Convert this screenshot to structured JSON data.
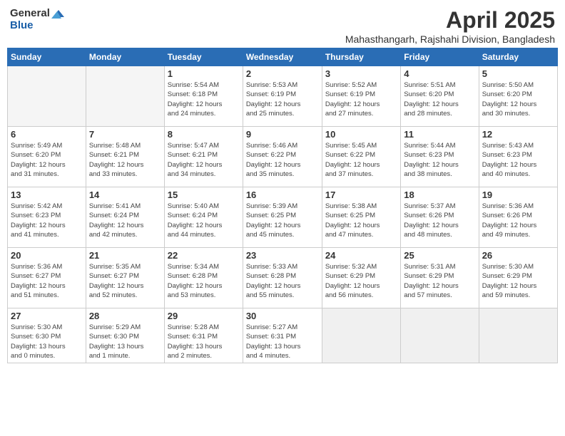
{
  "logo": {
    "general": "General",
    "blue": "Blue"
  },
  "title": "April 2025",
  "location": "Mahasthangarh, Rajshahi Division, Bangladesh",
  "headers": [
    "Sunday",
    "Monday",
    "Tuesday",
    "Wednesday",
    "Thursday",
    "Friday",
    "Saturday"
  ],
  "weeks": [
    [
      {
        "day": "",
        "info": ""
      },
      {
        "day": "",
        "info": ""
      },
      {
        "day": "1",
        "info": "Sunrise: 5:54 AM\nSunset: 6:18 PM\nDaylight: 12 hours\nand 24 minutes."
      },
      {
        "day": "2",
        "info": "Sunrise: 5:53 AM\nSunset: 6:19 PM\nDaylight: 12 hours\nand 25 minutes."
      },
      {
        "day": "3",
        "info": "Sunrise: 5:52 AM\nSunset: 6:19 PM\nDaylight: 12 hours\nand 27 minutes."
      },
      {
        "day": "4",
        "info": "Sunrise: 5:51 AM\nSunset: 6:20 PM\nDaylight: 12 hours\nand 28 minutes."
      },
      {
        "day": "5",
        "info": "Sunrise: 5:50 AM\nSunset: 6:20 PM\nDaylight: 12 hours\nand 30 minutes."
      }
    ],
    [
      {
        "day": "6",
        "info": "Sunrise: 5:49 AM\nSunset: 6:20 PM\nDaylight: 12 hours\nand 31 minutes."
      },
      {
        "day": "7",
        "info": "Sunrise: 5:48 AM\nSunset: 6:21 PM\nDaylight: 12 hours\nand 33 minutes."
      },
      {
        "day": "8",
        "info": "Sunrise: 5:47 AM\nSunset: 6:21 PM\nDaylight: 12 hours\nand 34 minutes."
      },
      {
        "day": "9",
        "info": "Sunrise: 5:46 AM\nSunset: 6:22 PM\nDaylight: 12 hours\nand 35 minutes."
      },
      {
        "day": "10",
        "info": "Sunrise: 5:45 AM\nSunset: 6:22 PM\nDaylight: 12 hours\nand 37 minutes."
      },
      {
        "day": "11",
        "info": "Sunrise: 5:44 AM\nSunset: 6:23 PM\nDaylight: 12 hours\nand 38 minutes."
      },
      {
        "day": "12",
        "info": "Sunrise: 5:43 AM\nSunset: 6:23 PM\nDaylight: 12 hours\nand 40 minutes."
      }
    ],
    [
      {
        "day": "13",
        "info": "Sunrise: 5:42 AM\nSunset: 6:23 PM\nDaylight: 12 hours\nand 41 minutes."
      },
      {
        "day": "14",
        "info": "Sunrise: 5:41 AM\nSunset: 6:24 PM\nDaylight: 12 hours\nand 42 minutes."
      },
      {
        "day": "15",
        "info": "Sunrise: 5:40 AM\nSunset: 6:24 PM\nDaylight: 12 hours\nand 44 minutes."
      },
      {
        "day": "16",
        "info": "Sunrise: 5:39 AM\nSunset: 6:25 PM\nDaylight: 12 hours\nand 45 minutes."
      },
      {
        "day": "17",
        "info": "Sunrise: 5:38 AM\nSunset: 6:25 PM\nDaylight: 12 hours\nand 47 minutes."
      },
      {
        "day": "18",
        "info": "Sunrise: 5:37 AM\nSunset: 6:26 PM\nDaylight: 12 hours\nand 48 minutes."
      },
      {
        "day": "19",
        "info": "Sunrise: 5:36 AM\nSunset: 6:26 PM\nDaylight: 12 hours\nand 49 minutes."
      }
    ],
    [
      {
        "day": "20",
        "info": "Sunrise: 5:36 AM\nSunset: 6:27 PM\nDaylight: 12 hours\nand 51 minutes."
      },
      {
        "day": "21",
        "info": "Sunrise: 5:35 AM\nSunset: 6:27 PM\nDaylight: 12 hours\nand 52 minutes."
      },
      {
        "day": "22",
        "info": "Sunrise: 5:34 AM\nSunset: 6:28 PM\nDaylight: 12 hours\nand 53 minutes."
      },
      {
        "day": "23",
        "info": "Sunrise: 5:33 AM\nSunset: 6:28 PM\nDaylight: 12 hours\nand 55 minutes."
      },
      {
        "day": "24",
        "info": "Sunrise: 5:32 AM\nSunset: 6:29 PM\nDaylight: 12 hours\nand 56 minutes."
      },
      {
        "day": "25",
        "info": "Sunrise: 5:31 AM\nSunset: 6:29 PM\nDaylight: 12 hours\nand 57 minutes."
      },
      {
        "day": "26",
        "info": "Sunrise: 5:30 AM\nSunset: 6:29 PM\nDaylight: 12 hours\nand 59 minutes."
      }
    ],
    [
      {
        "day": "27",
        "info": "Sunrise: 5:30 AM\nSunset: 6:30 PM\nDaylight: 13 hours\nand 0 minutes."
      },
      {
        "day": "28",
        "info": "Sunrise: 5:29 AM\nSunset: 6:30 PM\nDaylight: 13 hours\nand 1 minute."
      },
      {
        "day": "29",
        "info": "Sunrise: 5:28 AM\nSunset: 6:31 PM\nDaylight: 13 hours\nand 2 minutes."
      },
      {
        "day": "30",
        "info": "Sunrise: 5:27 AM\nSunset: 6:31 PM\nDaylight: 13 hours\nand 4 minutes."
      },
      {
        "day": "",
        "info": ""
      },
      {
        "day": "",
        "info": ""
      },
      {
        "day": "",
        "info": ""
      }
    ]
  ]
}
